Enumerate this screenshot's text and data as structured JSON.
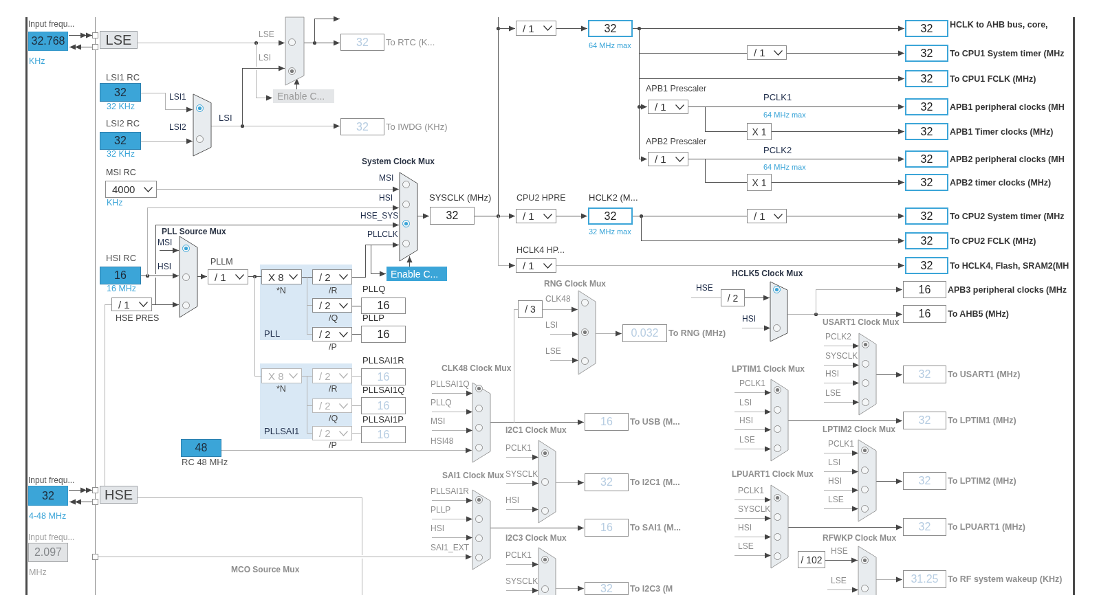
{
  "input_fields": [
    {
      "caption": "Input frequ...",
      "value": "32.768",
      "unit": "KHz",
      "enabled": true
    },
    {
      "caption": "Input frequ...",
      "value": "32",
      "unit": "4-48 MHz",
      "enabled": true
    },
    {
      "caption": "Input frequ...",
      "value": "2.097",
      "unit": "MHz",
      "enabled": false
    }
  ],
  "oscillators": [
    {
      "label": "LSE"
    },
    {
      "label": "HSE"
    }
  ],
  "rc_oscillators": [
    {
      "caption": "LSI1 RC",
      "value": "32",
      "unit": "32 KHz"
    },
    {
      "caption": "LSI2 RC",
      "value": "32",
      "unit": "32 KHz"
    },
    {
      "caption": "HSI RC",
      "value": "16",
      "unit": "16 MHz"
    },
    {
      "caption": "RC 48 MHz",
      "value": "48"
    }
  ],
  "prescalers": [
    {
      "caption": "MSI RC",
      "value": "4000",
      "unit": "KHz",
      "enabled": true
    },
    {
      "caption": "HSE PRES",
      "value": "/ 1",
      "enabled": true
    },
    {
      "caption": "PLLM",
      "value": "/ 1",
      "enabled": true
    },
    {
      "caption": "*N",
      "value": "X 8",
      "enabled": true
    },
    {
      "caption": "/R",
      "value": "/ 2",
      "enabled": true
    },
    {
      "caption": "/Q",
      "value": "/ 2",
      "enabled": true
    },
    {
      "caption": "/P",
      "value": "/ 2",
      "enabled": true
    },
    {
      "caption": "*N",
      "value": "X 8",
      "enabled": false
    },
    {
      "caption": "/R",
      "value": "/ 2",
      "enabled": false
    },
    {
      "caption": "/Q",
      "value": "/ 2",
      "enabled": false
    },
    {
      "caption": "/P",
      "value": "/ 2",
      "enabled": false
    },
    {
      "value": "/ 1",
      "enabled": true
    },
    {
      "value": "/ 1",
      "enabled": true
    },
    {
      "caption": "APB1 Prescaler",
      "value": "/ 1",
      "enabled": true
    },
    {
      "caption": "APB2 Prescaler",
      "value": "/ 1",
      "enabled": true
    },
    {
      "caption": "CPU2 HPRE",
      "value": "/ 1",
      "enabled": true
    },
    {
      "caption": "HCLK4 HP...",
      "value": "/ 1",
      "enabled": true
    },
    {
      "value": "/ 1",
      "enabled": true
    }
  ],
  "fixed_dividers": [
    {
      "value": "/ 3"
    },
    {
      "value": "/ 2"
    },
    {
      "value": "/ 102"
    },
    {
      "value": "X 1"
    },
    {
      "value": "X 1"
    }
  ],
  "muxes": [
    {
      "enabled": false,
      "inputs": [
        {
          "label": "LSE",
          "selected": false
        },
        {
          "label": "LSI",
          "selected": true
        }
      ]
    },
    {
      "enabled": true,
      "inputs": [
        {
          "label": "LSI1",
          "selected": true
        },
        {
          "label": "LSI2",
          "selected": false
        }
      ]
    },
    {
      "title": "PLL Source Mux",
      "enabled": true,
      "inputs": [
        {
          "label": "MSI",
          "selected": true
        },
        {
          "label": "HSI",
          "selected": false
        },
        {
          "selected": false
        }
      ]
    },
    {
      "title": "System Clock Mux",
      "enabled": true,
      "inputs": [
        {
          "label": "MSI",
          "selected": false
        },
        {
          "label": "HSI",
          "selected": false
        },
        {
          "label": "HSE_SYS",
          "selected": true
        },
        {
          "label": "PLLCLK",
          "selected": false
        }
      ]
    },
    {
      "title": "RNG Clock Mux",
      "enabled": false,
      "inputs": [
        {
          "label": "CLK48",
          "selected": false
        },
        {
          "label": "LSI",
          "selected": true
        },
        {
          "label": "LSE",
          "selected": false
        }
      ]
    },
    {
      "title": "HCLK5 Clock Mux",
      "enabled": true,
      "inputs": [
        {
          "label": "HSE",
          "selected": true
        },
        {
          "label": "HSI",
          "selected": false
        }
      ]
    },
    {
      "title": "CLK48 Clock Mux",
      "enabled": false,
      "inputs": [
        {
          "label": "PLLSAI1Q",
          "selected": true
        },
        {
          "label": "PLLQ",
          "selected": false
        },
        {
          "label": "MSI",
          "selected": false
        },
        {
          "label": "HSI48",
          "selected": false
        }
      ]
    },
    {
      "title": "I2C1 Clock Mux",
      "enabled": false,
      "inputs": [
        {
          "label": "PCLK1",
          "selected": true
        },
        {
          "label": "SYSCLK",
          "selected": false
        },
        {
          "label": "HSI",
          "selected": false
        }
      ]
    },
    {
      "title": "SAI1 Clock Mux",
      "enabled": false,
      "inputs": [
        {
          "label": "PLLSAI1R",
          "selected": true
        },
        {
          "label": "PLLP",
          "selected": false
        },
        {
          "label": "HSI",
          "selected": false
        },
        {
          "label": "SAI1_EXT",
          "selected": false
        }
      ]
    },
    {
      "title": "I2C3 Clock Mux",
      "enabled": false,
      "inputs": [
        {
          "label": "PCLK1",
          "selected": true
        },
        {
          "label": "SYSCLK",
          "selected": false
        }
      ]
    },
    {
      "title": "USART1 Clock Mux",
      "enabled": false,
      "inputs": [
        {
          "label": "PCLK2",
          "selected": true
        },
        {
          "label": "SYSCLK",
          "selected": false
        },
        {
          "label": "HSI",
          "selected": false
        },
        {
          "label": "LSE",
          "selected": false
        }
      ]
    },
    {
      "title": "LPTIM1 Clock Mux",
      "enabled": false,
      "inputs": [
        {
          "label": "PCLK1",
          "selected": true
        },
        {
          "label": "LSI",
          "selected": false
        },
        {
          "label": "HSI",
          "selected": false
        },
        {
          "label": "LSE",
          "selected": false
        }
      ]
    },
    {
      "title": "LPTIM2 Clock Mux",
      "enabled": false,
      "inputs": [
        {
          "label": "PCLK1",
          "selected": true
        },
        {
          "label": "LSI",
          "selected": false
        },
        {
          "label": "HSI",
          "selected": false
        },
        {
          "label": "LSE",
          "selected": false
        }
      ]
    },
    {
      "title": "LPUART1 Clock Mux",
      "enabled": false,
      "inputs": [
        {
          "label": "PCLK1",
          "selected": true
        },
        {
          "label": "SYSCLK",
          "selected": false
        },
        {
          "label": "HSI",
          "selected": false
        },
        {
          "label": "LSE",
          "selected": false
        }
      ]
    },
    {
      "title": "RFWKP Clock Mux",
      "enabled": false,
      "inputs": [
        {
          "label": "HSE",
          "selected": true
        },
        {
          "label": "LSE",
          "selected": false
        }
      ]
    }
  ],
  "buttons": [
    {
      "label": "Enable C...",
      "enabled": false
    },
    {
      "label": "Enable C...",
      "enabled": true
    }
  ],
  "outputs": [
    {
      "value": "32",
      "label": "To RTC (K...",
      "kind": "off"
    },
    {
      "value": "32",
      "label": "To IWDG (KHz)",
      "kind": "off"
    },
    {
      "value": "32",
      "label": "SYSCLK (MHz)",
      "kind": "plain"
    },
    {
      "value": "32",
      "note": "64 MHz max",
      "kind": "bus"
    },
    {
      "value": "32",
      "label": "HCLK2 (M...",
      "note": "32 MHz max",
      "kind": "bus"
    },
    {
      "value": "16",
      "label": "PLLQ",
      "kind": "plain"
    },
    {
      "value": "16",
      "label": "PLLP",
      "kind": "plain"
    },
    {
      "value": "16",
      "label": "PLLSAI1R",
      "kind": "off"
    },
    {
      "value": "16",
      "label": "PLLSAI1Q",
      "kind": "off"
    },
    {
      "value": "16",
      "label": "PLLSAI1P",
      "kind": "off"
    },
    {
      "value": "32",
      "label": "HCLK to AHB bus, core,",
      "kind": "bus"
    },
    {
      "value": "32",
      "label": "To CPU1 System timer (MHz",
      "kind": "bus"
    },
    {
      "value": "32",
      "label": "To CPU1 FCLK (MHz)",
      "kind": "bus"
    },
    {
      "value": "32",
      "label": "APB1 peripheral clocks (MH",
      "kind": "bus"
    },
    {
      "value": "32",
      "label": "APB1 Timer clocks (MHz)",
      "kind": "bus"
    },
    {
      "value": "32",
      "label": "APB2 peripheral clocks (MH",
      "kind": "bus"
    },
    {
      "value": "32",
      "label": "APB2 timer clocks (MHz)",
      "kind": "bus"
    },
    {
      "value": "32",
      "label": "To CPU2 System timer (MHz",
      "kind": "bus"
    },
    {
      "value": "32",
      "label": "To CPU2 FCLK (MHz)",
      "kind": "bus"
    },
    {
      "value": "32",
      "label": "To HCLK4, Flash, SRAM2(MH",
      "kind": "bus"
    },
    {
      "value": "16",
      "label": "APB3 peripheral clocks (MHz",
      "kind": "plain"
    },
    {
      "value": "16",
      "label": "To AHB5 (MHz)",
      "kind": "plain"
    },
    {
      "value": "0.032",
      "label": "To RNG (MHz)",
      "kind": "off"
    },
    {
      "value": "16",
      "label": "To USB (M...",
      "kind": "off"
    },
    {
      "value": "32",
      "label": "To I2C1 (M...",
      "kind": "off"
    },
    {
      "value": "16",
      "label": "To SAI1 (M...",
      "kind": "off"
    },
    {
      "value": "32",
      "label": "To I2C3 (M",
      "kind": "off"
    },
    {
      "value": "32",
      "label": "To USART1 (MHz)",
      "kind": "off"
    },
    {
      "value": "32",
      "label": "To LPTIM1 (MHz)",
      "kind": "off"
    },
    {
      "value": "32",
      "label": "To LPTIM2 (MHz)",
      "kind": "off"
    },
    {
      "value": "32",
      "label": "To LPUART1 (MHz)",
      "kind": "off"
    },
    {
      "value": "31.25",
      "label": "To RF system wakeup (KHz)",
      "kind": "off"
    }
  ],
  "labels": [
    {
      "text": "LSI",
      "kind": "name"
    },
    {
      "text": "PLL",
      "kind": "name"
    },
    {
      "text": "PLLSAI1",
      "kind": "name"
    },
    {
      "text": "MCO Source Mux",
      "kind": "title"
    },
    {
      "text": "PCLK1",
      "kind": "name"
    },
    {
      "text": "64 MHz max",
      "kind": "note"
    },
    {
      "text": "PCLK2",
      "kind": "name"
    },
    {
      "text": "64 MHz max",
      "kind": "note"
    }
  ]
}
